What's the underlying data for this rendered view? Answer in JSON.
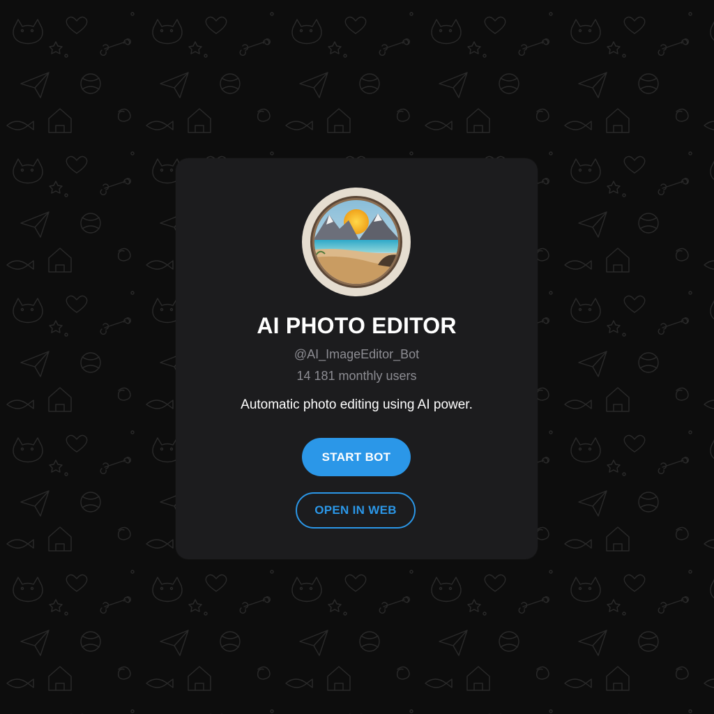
{
  "bot": {
    "title": "AI PHOTO EDITOR",
    "handle": "@AI_ImageEditor_Bot",
    "monthly_users": "14 181 monthly users",
    "description": "Automatic photo editing using AI power."
  },
  "actions": {
    "start_label": "START BOT",
    "web_label": "OPEN IN WEB"
  },
  "colors": {
    "accent": "#2b97e8",
    "card_bg": "#1c1c1e",
    "page_bg": "#0d0d0d"
  },
  "icons": {
    "avatar": "beach-landscape-avatar"
  }
}
